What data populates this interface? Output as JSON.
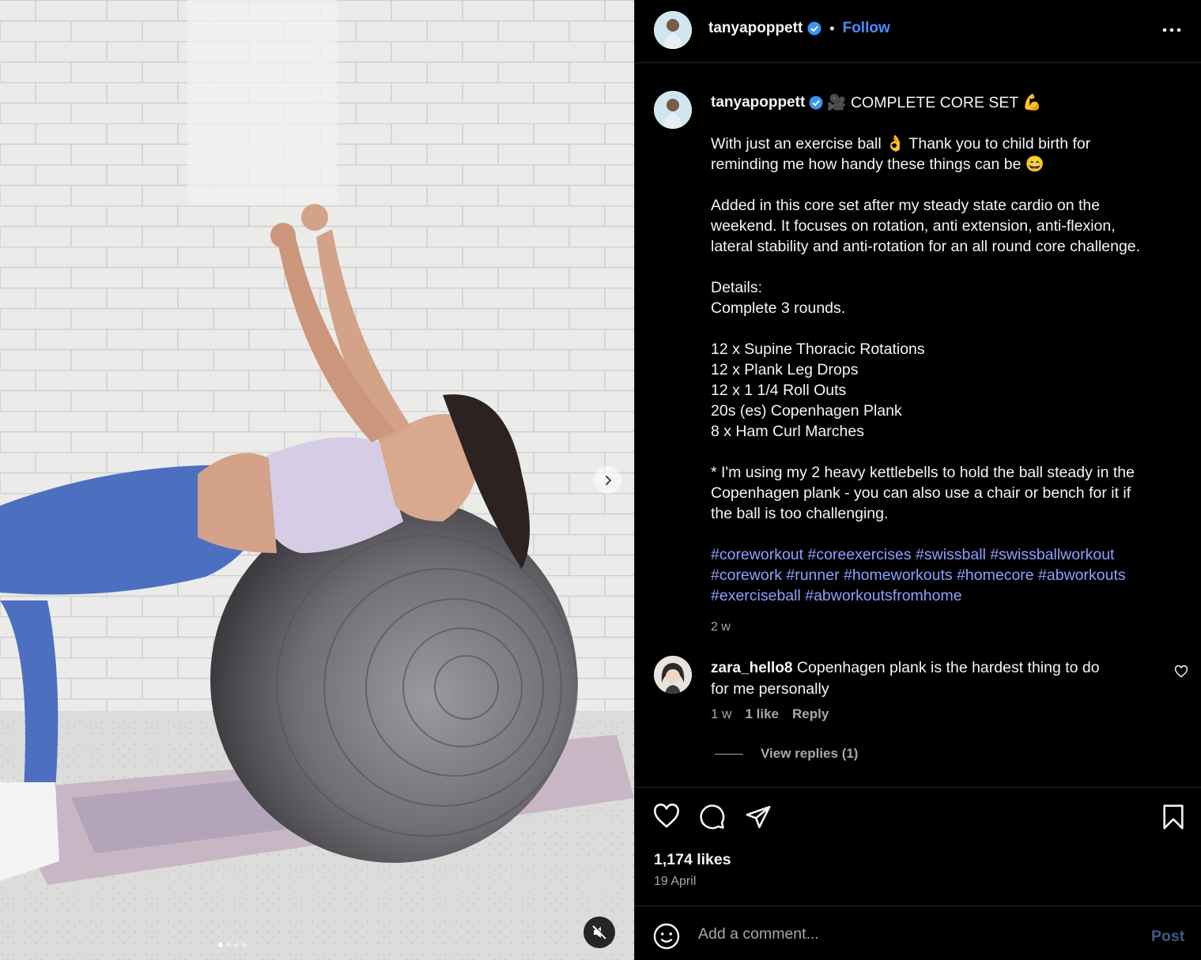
{
  "post": {
    "author": "tanyapoppett",
    "follow_label": "Follow",
    "separator": "•",
    "more_icon": "more-horizontal-icon",
    "verified_color": "#3897f0"
  },
  "caption": {
    "author": "tanyapoppett",
    "title": "🎥 COMPLETE CORE SET 💪",
    "lines": [
      "With just an exercise ball 👌 Thank you to child birth for",
      "reminding me how handy these things can be 😄",
      "",
      "Added in this core set after my steady state cardio on the",
      "weekend. It focuses on rotation, anti extension, anti-flexion,",
      "lateral stability and anti-rotation for an all round core challenge.",
      "",
      "Details:",
      "Complete 3 rounds.",
      "",
      "12 x Supine Thoracic Rotations",
      "12 x Plank Leg Drops",
      "12 x 1 1/4 Roll Outs",
      "20s (es) Copenhagen Plank",
      "8 x Ham Curl Marches",
      "",
      "* I'm using my 2 heavy kettlebells to hold the ball steady in the",
      "Copenhagen plank - you can also use a chair or bench for it if",
      "the ball is too challenging.",
      ""
    ],
    "hashtag_lines": [
      "#coreworkout #coreexercises #swissball #swissballworkout",
      "#corework #runner #homeworkouts #homecore #abworkouts",
      "#exerciseball #abworkoutsfromhome"
    ],
    "time": "2 w"
  },
  "comment": {
    "author": "zara_hello8",
    "text_line1": "Copenhagen plank is the hardest thing to do",
    "text_line2": "for me personally",
    "time": "1 w",
    "likes": "1 like",
    "reply_label": "Reply",
    "view_replies": "View replies (1)"
  },
  "actions": {
    "likes": "1,174 likes",
    "date": "19 April"
  },
  "comment_box": {
    "placeholder": "Add a comment...",
    "post_label": "Post"
  },
  "carousel": {
    "total_slides": 4,
    "active_slide": 1
  },
  "colors": {
    "background": "#000000",
    "link_blue": "#4a8cff",
    "hashtag": "#8ea0ff",
    "muted": "#a8a8a8"
  }
}
